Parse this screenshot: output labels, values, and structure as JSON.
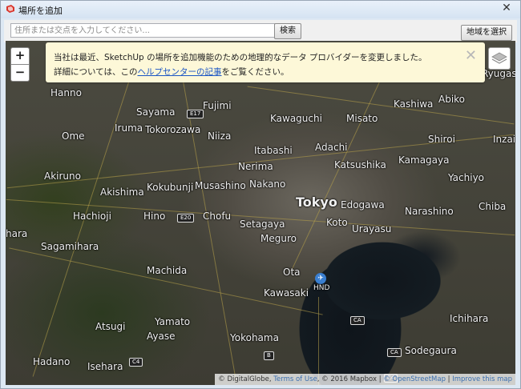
{
  "window": {
    "title": "場所を追加",
    "close_glyph": "✕"
  },
  "toolbar": {
    "search_placeholder": "住所または交点を入力してください...",
    "search_label": "検索",
    "select_region_label": "地域を選択"
  },
  "notice": {
    "line1": "当社は最近、SketchUp の場所を追加機能のための地理的なデータ プロバイダーを変更しました。",
    "line2_prefix": "詳細については、この",
    "line2_link": "ヘルプセンターの記事",
    "line2_suffix": "をご覧ください。",
    "close_glyph": "✕"
  },
  "map_controls": {
    "zoom_in": "+",
    "zoom_out": "−"
  },
  "places": [
    {
      "name": "Tokyo",
      "big": true
    },
    {
      "name": "Hanno"
    },
    {
      "name": "Sayama"
    },
    {
      "name": "Fujimi"
    },
    {
      "name": "Kawaguchi"
    },
    {
      "name": "Misato"
    },
    {
      "name": "Kashiwa"
    },
    {
      "name": "Abiko"
    },
    {
      "name": "Ryugasa"
    },
    {
      "name": "Iruma"
    },
    {
      "name": "Tokorozawa"
    },
    {
      "name": "Niiza"
    },
    {
      "name": "Ome"
    },
    {
      "name": "Shiroi"
    },
    {
      "name": "Inzai"
    },
    {
      "name": "Itabashi"
    },
    {
      "name": "Adachi"
    },
    {
      "name": "Kamagaya"
    },
    {
      "name": "Nerima"
    },
    {
      "name": "Katsushika"
    },
    {
      "name": "Akiruno"
    },
    {
      "name": "Yachiyo"
    },
    {
      "name": "Akishima"
    },
    {
      "name": "Kokubunji"
    },
    {
      "name": "Musashino"
    },
    {
      "name": "Nakano"
    },
    {
      "name": "Edogawa"
    },
    {
      "name": "Hachioji"
    },
    {
      "name": "Hino"
    },
    {
      "name": "Chofu"
    },
    {
      "name": "Koto"
    },
    {
      "name": "Narashino"
    },
    {
      "name": "Chiba"
    },
    {
      "name": "Setagaya"
    },
    {
      "name": "Urayasu"
    },
    {
      "name": "hara"
    },
    {
      "name": "Meguro"
    },
    {
      "name": "Sagamihara"
    },
    {
      "name": "Machida"
    },
    {
      "name": "Ota"
    },
    {
      "name": "Kawasaki"
    },
    {
      "name": "Atsugi"
    },
    {
      "name": "Yamato"
    },
    {
      "name": "Ayase"
    },
    {
      "name": "Yokohama"
    },
    {
      "name": "Ichihara"
    },
    {
      "name": "Sodegaura"
    },
    {
      "name": "Hadano"
    },
    {
      "name": "Isehara"
    }
  ],
  "shields": [
    "E17",
    "E20",
    "B",
    "C4",
    "CA",
    "CA",
    "C4"
  ],
  "airport_label": "HND",
  "attribution": {
    "prefix": "© DigitalGlobe, ",
    "terms": "Terms of Use",
    "middle": ", © 2016 Mapbox",
    "sep1": " | ",
    "osm": "© OpenStreetMap",
    "sep2": " | ",
    "improve": "Improve this map"
  }
}
